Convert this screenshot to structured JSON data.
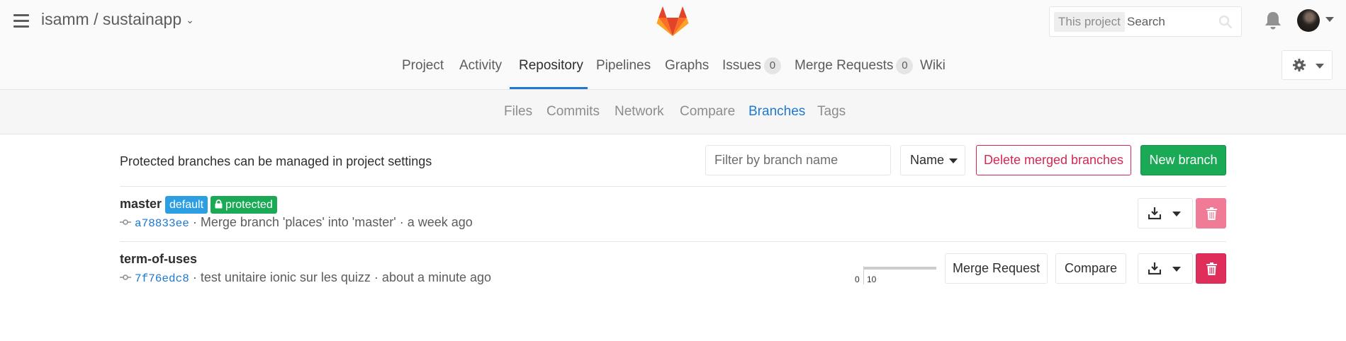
{
  "header": {
    "project_path": "isamm / sustainapp",
    "search": {
      "scope": "This project",
      "placeholder": "Search"
    }
  },
  "nav": {
    "items": [
      {
        "label": "Project"
      },
      {
        "label": "Activity"
      },
      {
        "label": "Repository",
        "active": true
      },
      {
        "label": "Pipelines"
      },
      {
        "label": "Graphs"
      },
      {
        "label": "Issues",
        "count": "0"
      },
      {
        "label": "Merge Requests",
        "count": "0"
      },
      {
        "label": "Wiki"
      }
    ]
  },
  "subnav": {
    "items": [
      {
        "label": "Files"
      },
      {
        "label": "Commits"
      },
      {
        "label": "Network"
      },
      {
        "label": "Compare"
      },
      {
        "label": "Branches",
        "active": true
      },
      {
        "label": "Tags"
      }
    ]
  },
  "toolbar": {
    "info": "Protected branches can be managed in project settings",
    "filter_placeholder": "Filter by branch name",
    "sort_label": "Name",
    "delete_merged_label": "Delete merged branches",
    "new_branch_label": "New branch"
  },
  "branches": [
    {
      "name": "master",
      "labels": {
        "default": "default",
        "protected": "protected"
      },
      "sha": "a78833ee",
      "message": "· Merge branch 'places' into 'master' · a week ago",
      "delete_disabled": true
    },
    {
      "name": "term-of-uses",
      "sha": "7f76edc8",
      "message": "· test unitaire ionic sur les quizz · about a minute ago",
      "divergence": {
        "behind": "0",
        "ahead": "10"
      },
      "merge_request_label": "Merge Request",
      "compare_label": "Compare",
      "delete_disabled": false
    }
  ],
  "colors": {
    "accent": "#1f78d1",
    "success": "#1aaa55",
    "danger": "#d22852",
    "default_label": "#2b9fe2"
  },
  "icons": [
    "menu-icon",
    "gitlab-logo",
    "search-icon",
    "bell-icon",
    "gear-icon",
    "lock-icon",
    "commit-icon",
    "download-icon",
    "trash-icon"
  ]
}
